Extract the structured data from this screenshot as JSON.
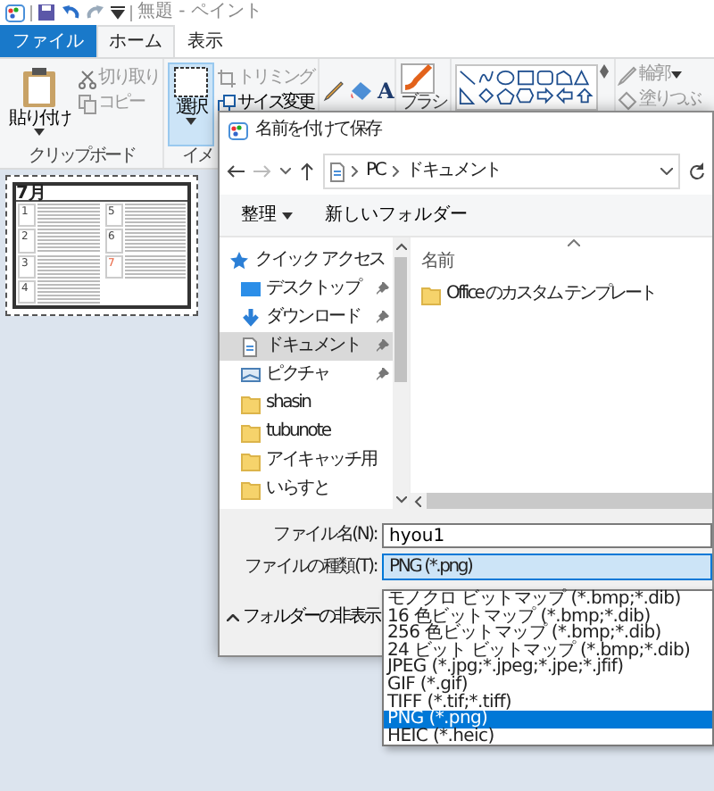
{
  "app": {
    "title": "無題 - ペイント"
  },
  "ribbon_tabs": [
    {
      "label": "ファイル",
      "kind": "file",
      "selected": false
    },
    {
      "label": "ホーム",
      "kind": "tab",
      "selected": true
    },
    {
      "label": "表示",
      "kind": "tab",
      "selected": false
    }
  ],
  "clipboard": {
    "paste": "貼り付け",
    "label": "クリップボード",
    "actions": [
      {
        "label": "切り取り",
        "kind": "cut",
        "disabled": true
      },
      {
        "label": "コピー",
        "kind": "copy",
        "disabled": true
      }
    ]
  },
  "image": {
    "select": "選択",
    "select_selected": true,
    "label": "イメ",
    "actions": [
      {
        "label": "トリミング",
        "kind": "crop",
        "disabled": true
      },
      {
        "label": "サイズ変更",
        "kind": "resize",
        "disabled": false
      }
    ]
  },
  "tools": {
    "text_tool": "A"
  },
  "brushes": {
    "label": "ブラシ"
  },
  "shapes": {
    "outline": "輪郭",
    "fill": "塗りつぶ"
  },
  "canvas_image": {
    "title": "7月",
    "cells": [
      {
        "label": "1",
        "color": "#444444"
      },
      {
        "label": "5",
        "color": "#444444"
      },
      {
        "label": "2",
        "color": "#444444"
      },
      {
        "label": "6",
        "color": "#444444"
      },
      {
        "label": "3",
        "color": "#444444"
      },
      {
        "label": "7",
        "color": "#e8603c"
      },
      {
        "label": "4",
        "color": "#444444"
      }
    ]
  },
  "dialog": {
    "title": "名前を付けて保存",
    "path": [
      "PC",
      "ドキュメント"
    ],
    "toolbar": {
      "organize": "整理",
      "new_folder": "新しいフォルダー"
    },
    "nav": [
      {
        "label": "クイック アクセス",
        "kind": "quick",
        "pinned": false,
        "selected": false
      },
      {
        "label": "デスクトップ",
        "kind": "desktop",
        "pinned": true,
        "selected": false
      },
      {
        "label": "ダウンロード",
        "kind": "download",
        "pinned": true,
        "selected": false
      },
      {
        "label": "ドキュメント",
        "kind": "document",
        "pinned": true,
        "selected": true
      },
      {
        "label": "ピクチャ",
        "kind": "picture",
        "pinned": true,
        "selected": false
      },
      {
        "label": "shasin",
        "kind": "folder",
        "pinned": false,
        "selected": false
      },
      {
        "label": "tubunote",
        "kind": "folder",
        "pinned": false,
        "selected": false
      },
      {
        "label": "アイキャッチ用",
        "kind": "folder",
        "pinned": false,
        "selected": false
      },
      {
        "label": "いらすと",
        "kind": "folder",
        "pinned": false,
        "selected": false
      }
    ],
    "column": "名前",
    "files": [
      "Office のカスタム テンプレート"
    ],
    "file_name_label": "ファイル名(N):",
    "file_name": "hyou1",
    "file_type_label": "ファイルの種類(T):",
    "file_type": "PNG (*.png)",
    "type_options": [
      {
        "label": "モノクロ ビットマップ (*.bmp;*.dib)",
        "selected": false
      },
      {
        "label": "16 色ビットマップ (*.bmp;*.dib)",
        "selected": false
      },
      {
        "label": "256 色ビットマップ (*.bmp;*.dib)",
        "selected": false
      },
      {
        "label": "24 ビット ビットマップ (*.bmp;*.dib)",
        "selected": false
      },
      {
        "label": "JPEG (*.jpg;*.jpeg;*.jpe;*.jfif)",
        "selected": false
      },
      {
        "label": "GIF (*.gif)",
        "selected": false
      },
      {
        "label": "TIFF (*.tif;*.tiff)",
        "selected": false
      },
      {
        "label": "PNG (*.png)",
        "selected": true
      },
      {
        "label": "HEIC (*.heic)",
        "selected": false
      }
    ],
    "hide_folders": "フォルダーの非表示"
  }
}
